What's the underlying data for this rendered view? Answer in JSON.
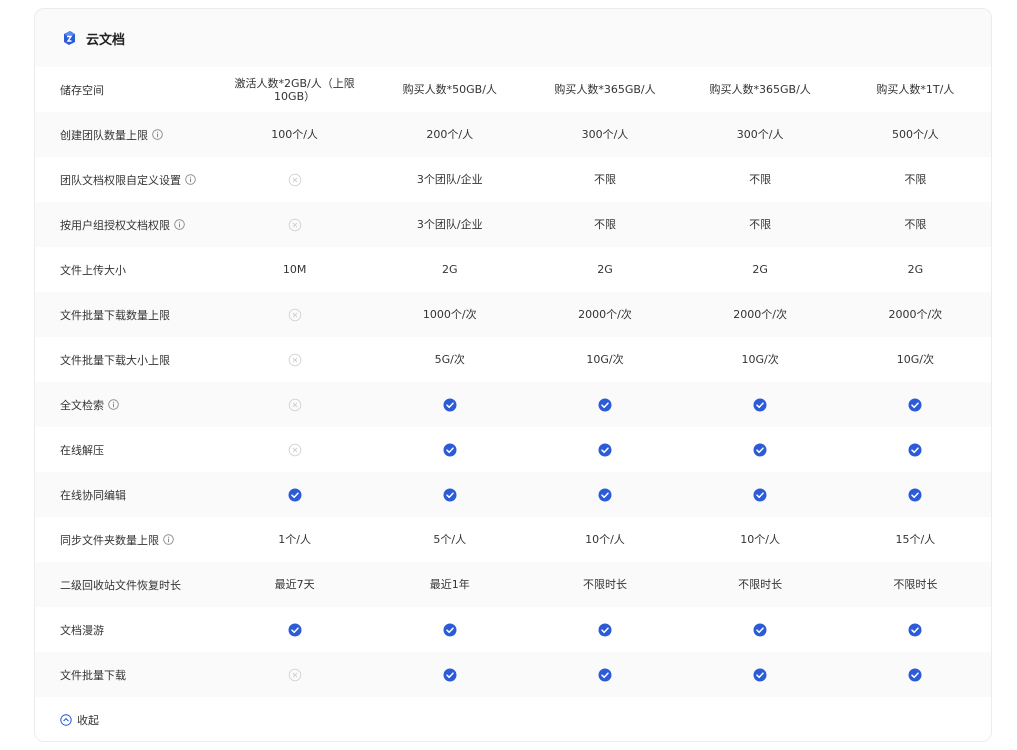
{
  "section": {
    "title": "云文档",
    "logo_icon": "cloud-doc-logo-icon",
    "accent": "#2c5bd8"
  },
  "plans": [
    "激活人数*2GB/人（上限10GB）",
    "购买人数*50GB/人",
    "购买人数*365GB/人",
    "购买人数*365GB/人",
    "购买人数*1T/人"
  ],
  "header_row_label": "储存空间",
  "rows": [
    {
      "label": "创建团队数量上限",
      "info": true,
      "values": [
        "100个/人",
        "200个/人",
        "300个/人",
        "300个/人",
        "500个/人"
      ]
    },
    {
      "label": "团队文档权限自定义设置",
      "info": true,
      "values": [
        "x",
        "3个团队/企业",
        "不限",
        "不限",
        "不限"
      ]
    },
    {
      "label": "按用户组授权文档权限",
      "info": true,
      "values": [
        "x",
        "3个团队/企业",
        "不限",
        "不限",
        "不限"
      ]
    },
    {
      "label": "文件上传大小",
      "info": false,
      "values": [
        "10M",
        "2G",
        "2G",
        "2G",
        "2G"
      ]
    },
    {
      "label": "文件批量下载数量上限",
      "info": false,
      "values": [
        "x",
        "1000个/次",
        "2000个/次",
        "2000个/次",
        "2000个/次"
      ]
    },
    {
      "label": "文件批量下载大小上限",
      "info": false,
      "values": [
        "x",
        "5G/次",
        "10G/次",
        "10G/次",
        "10G/次"
      ]
    },
    {
      "label": "全文检索",
      "info": true,
      "values": [
        "x",
        "check",
        "check",
        "check",
        "check"
      ]
    },
    {
      "label": "在线解压",
      "info": false,
      "values": [
        "x",
        "check",
        "check",
        "check",
        "check"
      ]
    },
    {
      "label": "在线协同编辑",
      "info": false,
      "values": [
        "check",
        "check",
        "check",
        "check",
        "check"
      ]
    },
    {
      "label": "同步文件夹数量上限",
      "info": true,
      "values": [
        "1个/人",
        "5个/人",
        "10个/人",
        "10个/人",
        "15个/人"
      ]
    },
    {
      "label": "二级回收站文件恢复时长",
      "info": false,
      "values": [
        "最近7天",
        "最近1年",
        "不限时长",
        "不限时长",
        "不限时长"
      ]
    },
    {
      "label": "文档漫游",
      "info": false,
      "values": [
        "check",
        "check",
        "check",
        "check",
        "check"
      ]
    },
    {
      "label": "文件批量下载",
      "info": false,
      "values": [
        "x",
        "check",
        "check",
        "check",
        "check"
      ]
    }
  ],
  "footer": {
    "collapse_label": "收起"
  }
}
